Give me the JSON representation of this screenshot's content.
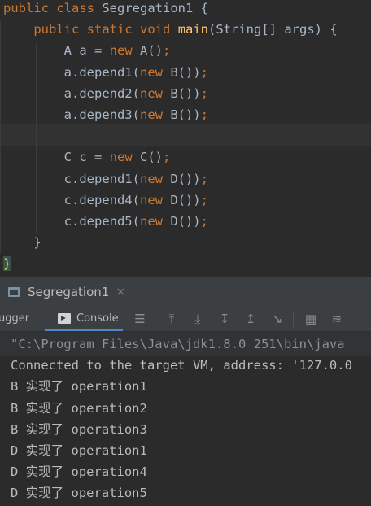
{
  "editor": {
    "lines": [
      [
        [
          "kw",
          "public"
        ],
        [
          "pl",
          " "
        ],
        [
          "kw",
          "class"
        ],
        [
          "pl",
          " Segregation1 {"
        ]
      ],
      [
        [
          "pl",
          "    "
        ],
        [
          "kw",
          "public"
        ],
        [
          "pl",
          " "
        ],
        [
          "kw",
          "static"
        ],
        [
          "pl",
          " "
        ],
        [
          "kw",
          "void"
        ],
        [
          "pl",
          " "
        ],
        [
          "fn",
          "main"
        ],
        [
          "pl",
          "(String[] args) {"
        ]
      ],
      [
        [
          "pl",
          "        A a = "
        ],
        [
          "kw",
          "new"
        ],
        [
          "pl",
          " A()"
        ],
        [
          "kw",
          ";"
        ]
      ],
      [
        [
          "pl",
          "        a.depend1("
        ],
        [
          "kw",
          "new"
        ],
        [
          "pl",
          " B())"
        ],
        [
          "kw",
          ";"
        ]
      ],
      [
        [
          "pl",
          "        a.depend2("
        ],
        [
          "kw",
          "new"
        ],
        [
          "pl",
          " B())"
        ],
        [
          "kw",
          ";"
        ]
      ],
      [
        [
          "pl",
          "        a.depend3("
        ],
        [
          "kw",
          "new"
        ],
        [
          "pl",
          " B())"
        ],
        [
          "kw",
          ";"
        ]
      ],
      [],
      [
        [
          "pl",
          "        C c = "
        ],
        [
          "kw",
          "new"
        ],
        [
          "pl",
          " C()"
        ],
        [
          "kw",
          ";"
        ]
      ],
      [
        [
          "pl",
          "        c.depend1("
        ],
        [
          "kw",
          "new"
        ],
        [
          "pl",
          " D())"
        ],
        [
          "kw",
          ";"
        ]
      ],
      [
        [
          "pl",
          "        c.depend4("
        ],
        [
          "kw",
          "new"
        ],
        [
          "pl",
          " D())"
        ],
        [
          "kw",
          ";"
        ]
      ],
      [
        [
          "pl",
          "        c.depend5("
        ],
        [
          "kw",
          "new"
        ],
        [
          "pl",
          " D())"
        ],
        [
          "kw",
          ";"
        ]
      ],
      [
        [
          "pl",
          "    }"
        ]
      ],
      [
        [
          "brace",
          "}"
        ]
      ]
    ]
  },
  "run_panel": {
    "tab_label": "Segregation1",
    "close_glyph": "×"
  },
  "toolbar": {
    "debugger_label": "ugger",
    "console_label": "Console"
  },
  "console": {
    "lines": [
      "\"C:\\Program Files\\Java\\jdk1.8.0_251\\bin\\java",
      "Connected to the target VM, address: '127.0.0",
      "B 实现了 operation1",
      "B 实现了 operation2",
      "B 实现了 operation3",
      "D 实现了 operation1",
      "D 实现了 operation4",
      "D 实现了 operation5"
    ]
  },
  "colors": {
    "keyword": "#cc7832",
    "method": "#ffc66d",
    "plain": "#a9b7c6",
    "accent": "#4a88c7"
  }
}
